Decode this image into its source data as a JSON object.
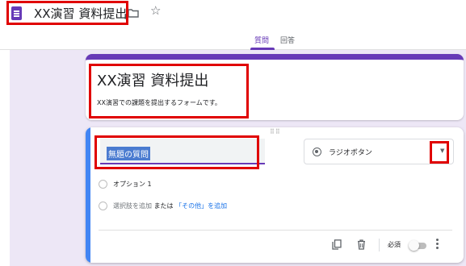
{
  "document": {
    "title": "XX演習 資料提出",
    "icons": [
      "forms-doc-icon",
      "folder-icon",
      "star-icon"
    ]
  },
  "tabs": [
    {
      "label": "質問",
      "active": true
    },
    {
      "label": "回答",
      "active": false
    }
  ],
  "form": {
    "title": "XX演習 資料提出",
    "description": "XX演習での課題を提出するフォームです。"
  },
  "question": {
    "title": "無題の質問",
    "type": "ラジオボタン",
    "options": [
      "オプション 1"
    ],
    "add_option": {
      "prefix": "選択肢を追加",
      "connector": "または",
      "other_link": "「その他」を追加"
    },
    "footer": {
      "required_label": "必須",
      "required": false
    }
  },
  "colors": {
    "accent": "#673ab7",
    "active_border": "#4285f4",
    "canvas": "#ede7f6",
    "link": "#1a73e8",
    "annotation": "#e00000"
  }
}
